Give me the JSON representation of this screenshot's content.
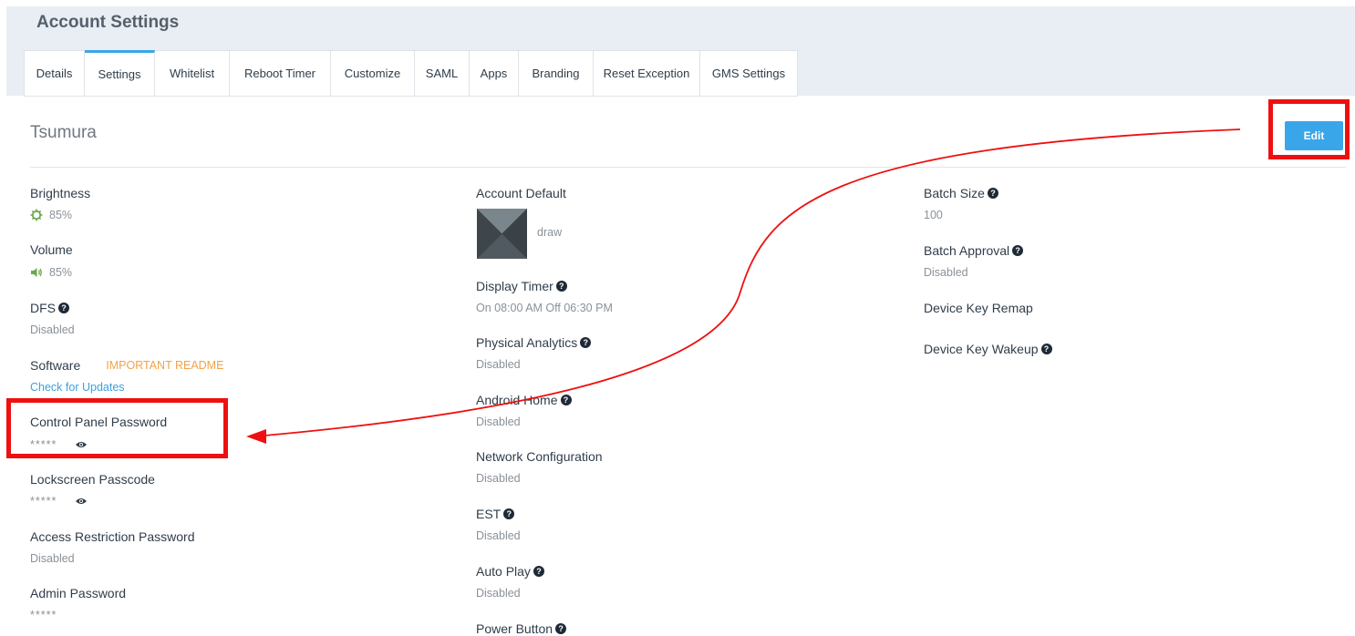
{
  "header": {
    "title": "Account Settings"
  },
  "tabs": [
    {
      "label": "Details"
    },
    {
      "label": "Settings"
    },
    {
      "label": "Whitelist"
    },
    {
      "label": "Reboot Timer"
    },
    {
      "label": "Customize"
    },
    {
      "label": "SAML"
    },
    {
      "label": "Apps"
    },
    {
      "label": "Branding"
    },
    {
      "label": "Reset Exception"
    },
    {
      "label": "GMS Settings"
    }
  ],
  "active_tab": "Settings",
  "account": {
    "name": "Tsumura"
  },
  "edit_label": "Edit",
  "col1": {
    "brightness": {
      "label": "Brightness",
      "value": "85%"
    },
    "volume": {
      "label": "Volume",
      "value": "85%"
    },
    "dfs": {
      "label": "DFS",
      "value": "Disabled"
    },
    "software": {
      "label": "Software",
      "readme": "IMPORTANT README",
      "update_link": "Check for Updates"
    },
    "control_panel_password": {
      "label": "Control Panel Password",
      "value": "*****"
    },
    "lockscreen_passcode": {
      "label": "Lockscreen Passcode",
      "value": "*****"
    },
    "access_restriction_password": {
      "label": "Access Restriction Password",
      "value": "Disabled"
    },
    "admin_password": {
      "label": "Admin Password",
      "value": "*****"
    }
  },
  "col2": {
    "account_default": {
      "label": "Account Default",
      "value": "draw"
    },
    "display_timer": {
      "label": "Display Timer",
      "value": "On 08:00 AM Off 06:30 PM"
    },
    "physical_analytics": {
      "label": "Physical Analytics",
      "value": "Disabled"
    },
    "android_home": {
      "label": "Android Home",
      "value": "Disabled"
    },
    "network_configuration": {
      "label": "Network Configuration",
      "value": "Disabled"
    },
    "est": {
      "label": "EST",
      "value": "Disabled"
    },
    "auto_play": {
      "label": "Auto Play",
      "value": "Disabled"
    },
    "power_button": {
      "label": "Power Button"
    }
  },
  "col3": {
    "batch_size": {
      "label": "Batch Size",
      "value": "100"
    },
    "batch_approval": {
      "label": "Batch Approval",
      "value": "Disabled"
    },
    "device_key_remap": {
      "label": "Device Key Remap"
    },
    "device_key_wakeup": {
      "label": "Device Key Wakeup"
    }
  },
  "icons": {
    "help": "question-circle-icon",
    "brightness": "sun-icon",
    "volume": "volume-icon",
    "reveal": "eye-icon"
  },
  "colors": {
    "accent": "#3aa6ea",
    "annotation": "#ee1010",
    "warning": "#f2a24a",
    "indicator_green": "#6aa84f"
  }
}
